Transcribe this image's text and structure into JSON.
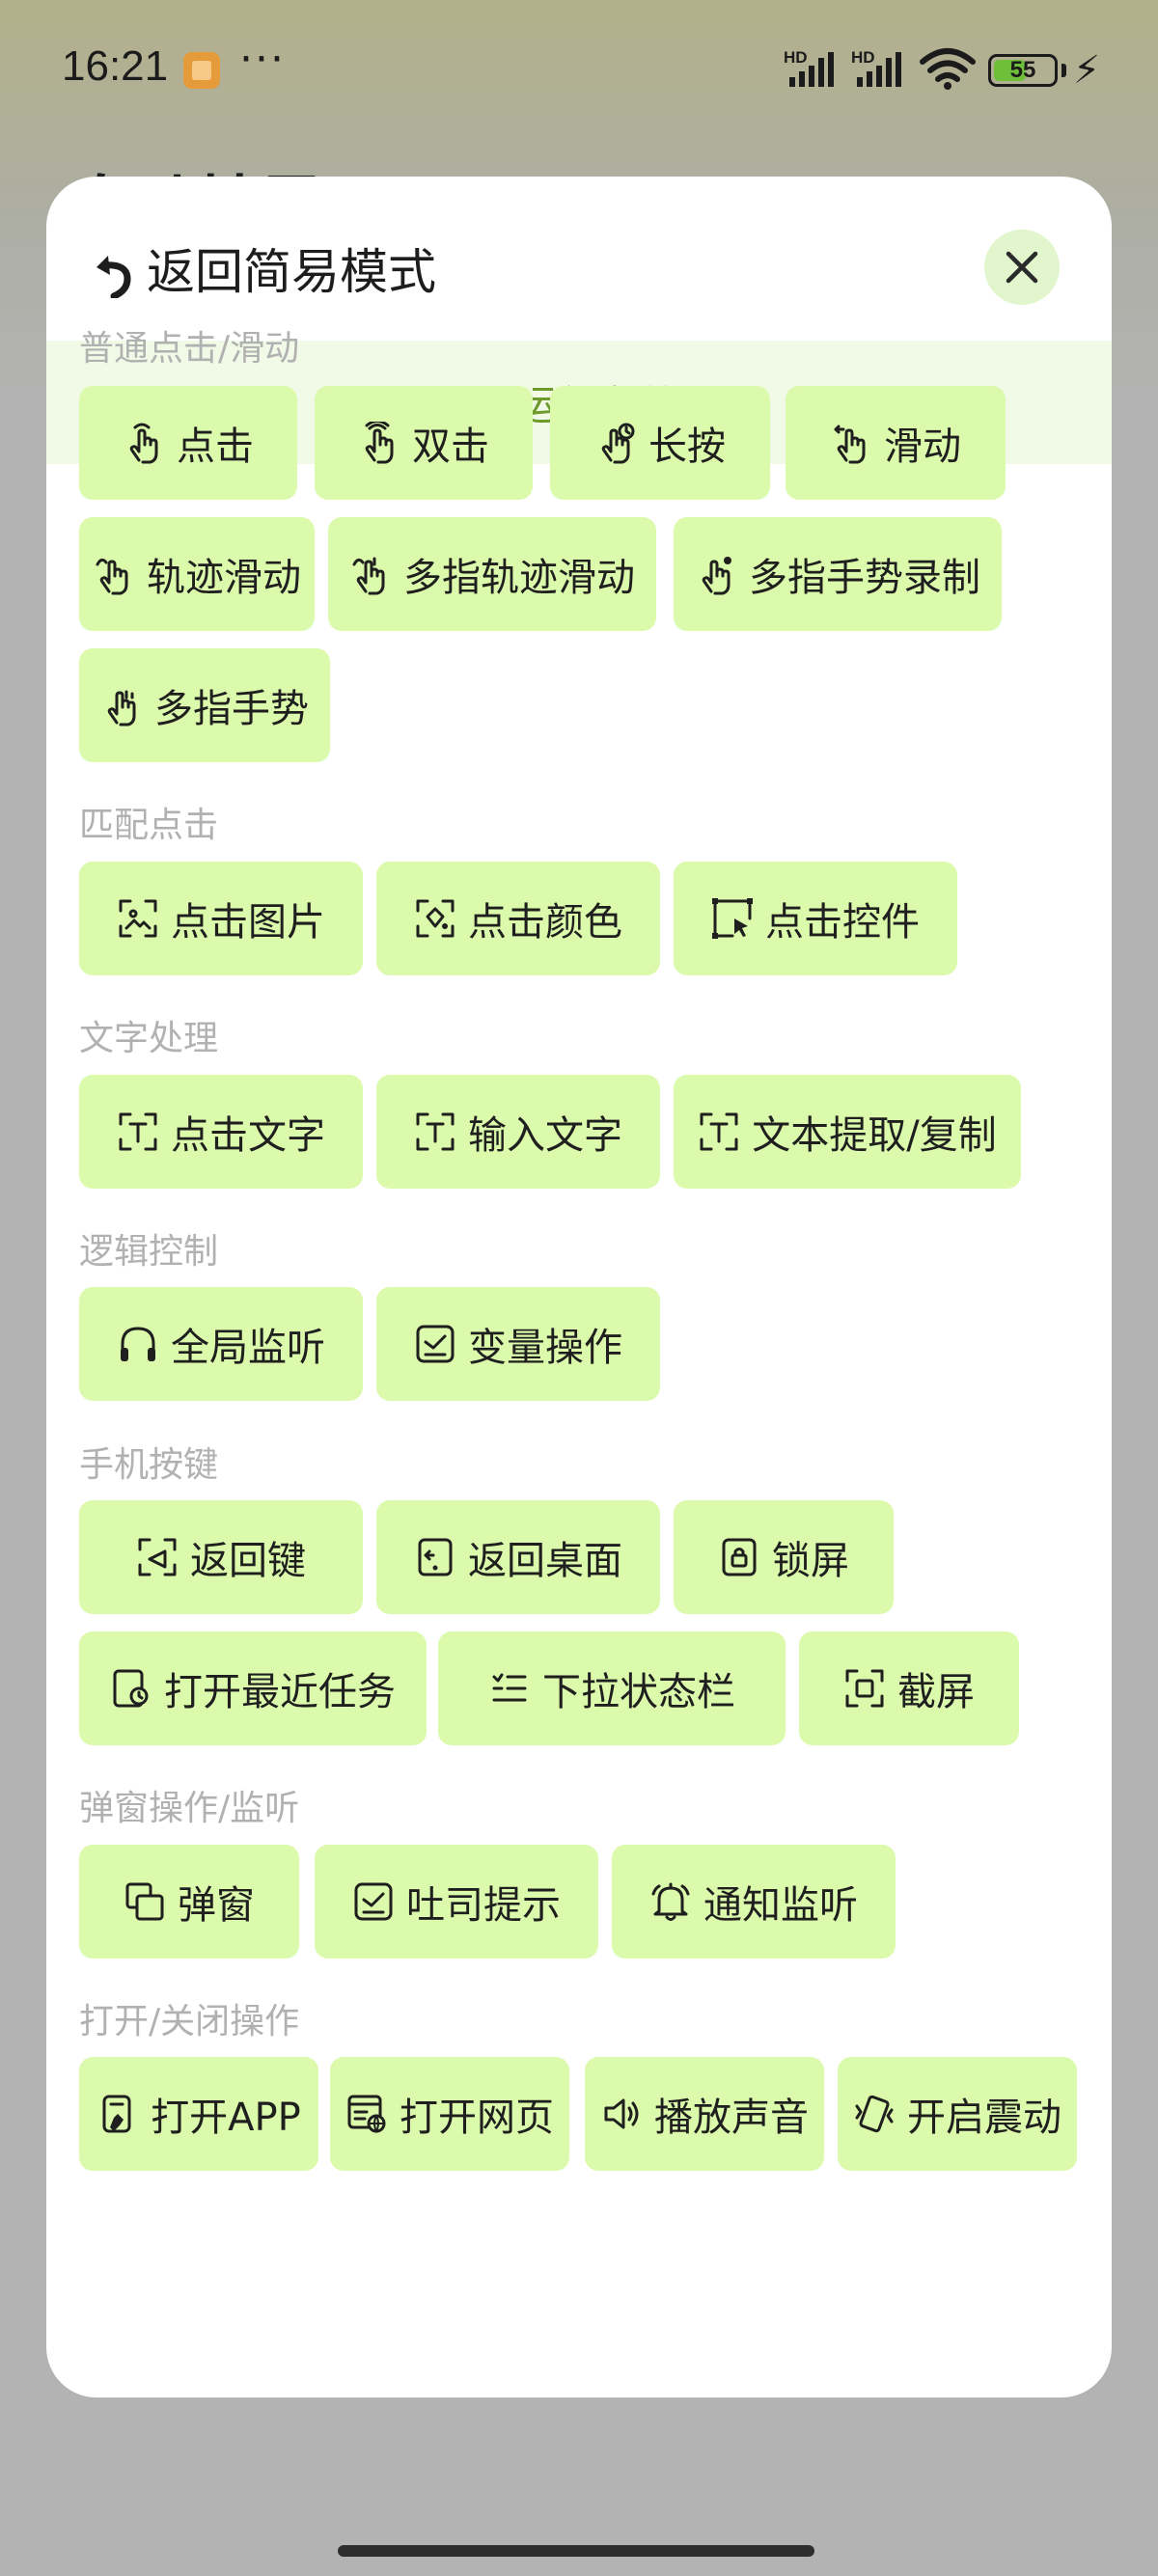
{
  "status_bar": {
    "time": "16:21",
    "more": "···",
    "signal1_label": "HD",
    "signal2_label": "HD",
    "battery_level": "55",
    "battery_fraction": 0.55
  },
  "background": {
    "title_partial": "自动精灵"
  },
  "sheet": {
    "title": "返回简易模式",
    "conditions_label": "设置运行条件"
  },
  "sections": [
    {
      "label": "普通点击/滑动",
      "items": [
        {
          "label": "点击",
          "icon": "tap-icon"
        },
        {
          "label": "双击",
          "icon": "double-tap-icon"
        },
        {
          "label": "长按",
          "icon": "long-press-icon"
        },
        {
          "label": "滑动",
          "icon": "swipe-icon"
        },
        {
          "label": "轨迹滑动",
          "icon": "trace-swipe-icon"
        },
        {
          "label": "多指轨迹滑动",
          "icon": "multi-trace-swipe-icon"
        },
        {
          "label": "多指手势录制",
          "icon": "gesture-record-icon"
        },
        {
          "label": "多指手势",
          "icon": "multi-gesture-icon"
        }
      ]
    },
    {
      "label": "匹配点击",
      "items": [
        {
          "label": "点击图片",
          "icon": "image-scan-icon"
        },
        {
          "label": "点击颜色",
          "icon": "color-scan-icon"
        },
        {
          "label": "点击控件",
          "icon": "widget-cursor-icon"
        }
      ]
    },
    {
      "label": "文字处理",
      "items": [
        {
          "label": "点击文字",
          "icon": "text-scan-icon"
        },
        {
          "label": "输入文字",
          "icon": "text-input-icon"
        },
        {
          "label": "文本提取/复制",
          "icon": "text-extract-icon"
        }
      ]
    },
    {
      "label": "逻辑控制",
      "items": [
        {
          "label": "全局监听",
          "icon": "headphones-icon"
        },
        {
          "label": "变量操作",
          "icon": "variable-check-icon"
        }
      ]
    },
    {
      "label": "手机按键",
      "items": [
        {
          "label": "返回键",
          "icon": "back-key-icon"
        },
        {
          "label": "返回桌面",
          "icon": "home-key-icon"
        },
        {
          "label": "锁屏",
          "icon": "lock-screen-icon"
        },
        {
          "label": "打开最近任务",
          "icon": "recent-tasks-icon"
        },
        {
          "label": "下拉状态栏",
          "icon": "status-bar-list-icon"
        },
        {
          "label": "截屏",
          "icon": "screenshot-icon"
        }
      ]
    },
    {
      "label": "弹窗操作/监听",
      "items": [
        {
          "label": "弹窗",
          "icon": "popup-window-icon"
        },
        {
          "label": "吐司提示",
          "icon": "toast-check-icon"
        },
        {
          "label": "通知监听",
          "icon": "bell-icon"
        }
      ]
    },
    {
      "label": "打开/关闭操作",
      "items": [
        {
          "label": "打开APP",
          "icon": "open-app-icon"
        },
        {
          "label": "打开网页",
          "icon": "open-webpage-icon"
        },
        {
          "label": "播放声音",
          "icon": "speaker-icon"
        },
        {
          "label": "开启震动",
          "icon": "vibrate-icon"
        }
      ]
    }
  ],
  "colors": {
    "chip_bg": "#dbfaab",
    "accent_green": "#6f9a2c",
    "conditions_bg": "#f0fae6",
    "section_label": "#b1b1b1",
    "close_bg": "#e2f6cd"
  }
}
